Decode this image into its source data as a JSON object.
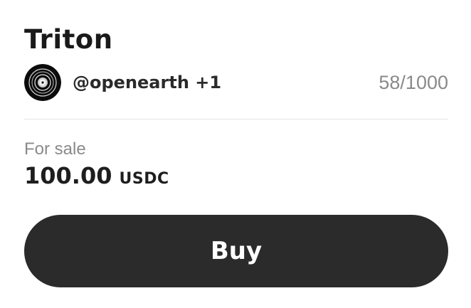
{
  "item": {
    "title": "Triton",
    "creator": "@openearth +1",
    "edition": "58/1000",
    "avatar_icon": "vinyl-record-icon"
  },
  "sale": {
    "label": "For sale",
    "price": "100.00",
    "currency": "USDC"
  },
  "actions": {
    "buy_label": "Buy"
  },
  "colors": {
    "button_bg": "#2b2b2b",
    "muted_text": "#8a8a8a",
    "divider": "#e4e4e4"
  }
}
